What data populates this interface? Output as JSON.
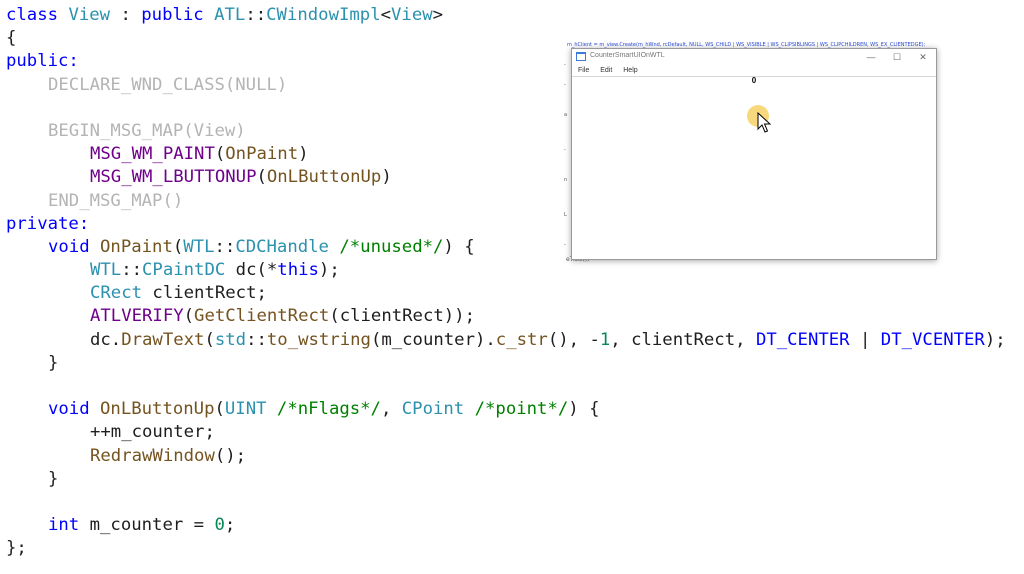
{
  "code": {
    "lines": [
      [
        {
          "t": "class ",
          "c": "kw"
        },
        {
          "t": "View",
          "c": "ty"
        },
        {
          "t": " : "
        },
        {
          "t": "public ",
          "c": "kw"
        },
        {
          "t": "ATL",
          "c": "ty"
        },
        {
          "t": "::"
        },
        {
          "t": "CWindowImpl",
          "c": "ty"
        },
        {
          "t": "<"
        },
        {
          "t": "View",
          "c": "ty"
        },
        {
          "t": ">"
        }
      ],
      [
        {
          "t": "{"
        }
      ],
      [
        {
          "t": "public:",
          "c": "kw"
        }
      ],
      [
        {
          "t": "DECLARE_WND_CLASS(NULL)",
          "c": "dim",
          "i": 1
        }
      ],
      [],
      [
        {
          "t": "BEGIN_MSG_MAP(View)",
          "c": "dim",
          "i": 1
        }
      ],
      [
        {
          "t": "MSG_WM_PAINT",
          "c": "mc",
          "i": 2
        },
        {
          "t": "("
        },
        {
          "t": "OnPaint",
          "c": "fn"
        },
        {
          "t": ")"
        }
      ],
      [
        {
          "t": "MSG_WM_LBUTTONUP",
          "c": "mc",
          "i": 2
        },
        {
          "t": "("
        },
        {
          "t": "OnLButtonUp",
          "c": "fn"
        },
        {
          "t": ")"
        }
      ],
      [
        {
          "t": "END_MSG_MAP()",
          "c": "dim",
          "i": 1
        }
      ],
      [
        {
          "t": "private:",
          "c": "kw"
        }
      ],
      [
        {
          "t": "void ",
          "c": "kw",
          "i": 1
        },
        {
          "t": "OnPaint",
          "c": "fn"
        },
        {
          "t": "("
        },
        {
          "t": "WTL",
          "c": "ty"
        },
        {
          "t": "::"
        },
        {
          "t": "CDCHandle",
          "c": "ty"
        },
        {
          "t": " "
        },
        {
          "t": "/*unused*/",
          "c": "cm"
        },
        {
          "t": ") {"
        }
      ],
      [
        {
          "t": "WTL",
          "c": "ty",
          "i": 2
        },
        {
          "t": "::"
        },
        {
          "t": "CPaintDC",
          "c": "ty"
        },
        {
          "t": " dc(*"
        },
        {
          "t": "this",
          "c": "kw"
        },
        {
          "t": ");"
        }
      ],
      [
        {
          "t": "CRect",
          "c": "ty",
          "i": 2
        },
        {
          "t": " clientRect;"
        }
      ],
      [
        {
          "t": "ATLVERIFY",
          "c": "mc",
          "i": 2
        },
        {
          "t": "("
        },
        {
          "t": "GetClientRect",
          "c": "fn"
        },
        {
          "t": "(clientRect));"
        }
      ],
      [
        {
          "t": "dc.",
          "i": 2
        },
        {
          "t": "DrawText",
          "c": "fn"
        },
        {
          "t": "("
        },
        {
          "t": "std",
          "c": "ty"
        },
        {
          "t": "::"
        },
        {
          "t": "to_wstring",
          "c": "fn"
        },
        {
          "t": "(m_counter)."
        },
        {
          "t": "c_str",
          "c": "fn"
        },
        {
          "t": "(), -"
        },
        {
          "t": "1",
          "c": "nm"
        },
        {
          "t": ", clientRect, "
        },
        {
          "t": "DT_CENTER",
          "c": "kw"
        },
        {
          "t": " | "
        },
        {
          "t": "DT_VCENTER",
          "c": "kw"
        },
        {
          "t": ");"
        }
      ],
      [
        {
          "t": "}",
          "i": 1
        }
      ],
      [],
      [
        {
          "t": "void ",
          "c": "kw",
          "i": 1
        },
        {
          "t": "OnLButtonUp",
          "c": "fn"
        },
        {
          "t": "("
        },
        {
          "t": "UINT",
          "c": "ty"
        },
        {
          "t": " "
        },
        {
          "t": "/*nFlags*/",
          "c": "cm"
        },
        {
          "t": ", "
        },
        {
          "t": "CPoint",
          "c": "ty"
        },
        {
          "t": " "
        },
        {
          "t": "/*point*/",
          "c": "cm"
        },
        {
          "t": ") {"
        }
      ],
      [
        {
          "t": "++m_counter;",
          "i": 2
        }
      ],
      [
        {
          "t": "RedrawWindow",
          "c": "fn",
          "i": 2
        },
        {
          "t": "();"
        }
      ],
      [
        {
          "t": "}",
          "i": 1
        }
      ],
      [],
      [
        {
          "t": "int ",
          "c": "kw",
          "i": 1
        },
        {
          "t": "m_counter = "
        },
        {
          "t": "0",
          "c": "nm"
        },
        {
          "t": ";"
        }
      ],
      [
        {
          "t": "};"
        }
      ]
    ]
  },
  "background_editor": {
    "top_text": "m_hClient = m_view.Create(m_hWnd, rcDefault, NULL, WS_CHILD | WS_VISIBLE | WS_CLIPSIBLINGS | WS_CLIPCHILDREN, WS_EX_CLIENTEDGE);",
    "status_text": "eTitle();"
  },
  "app_window": {
    "title": "CounterSmartUIOnWTL",
    "menu": [
      "File",
      "Edit",
      "Help"
    ],
    "counter_value": "0",
    "controls": {
      "minimize": "—",
      "maximize": "☐",
      "close": "✕"
    }
  }
}
